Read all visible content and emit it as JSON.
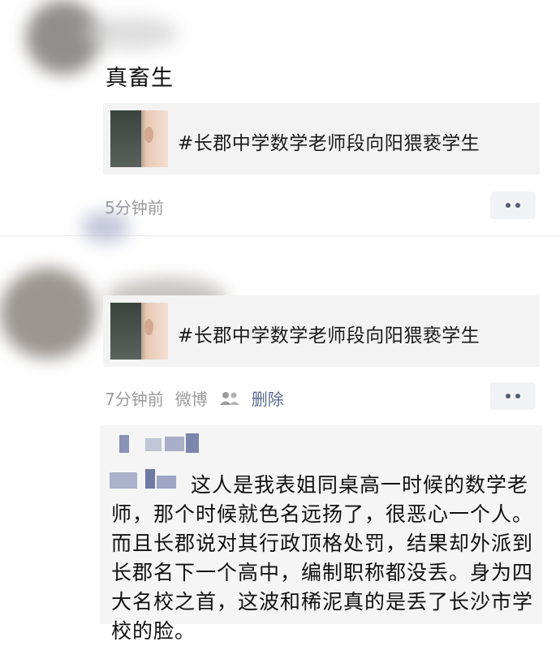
{
  "post1": {
    "text": "真畜生",
    "share_title": "#长郡中学数学老师段向阳猥亵学生",
    "time": "5分钟前"
  },
  "post2": {
    "share_title": "#长郡中学数学老师段向阳猥亵学生",
    "time": "7分钟前",
    "source": "微博",
    "delete_label": "删除"
  },
  "comment": {
    "text": "这人是我表姐同桌高一时候的数学老师，那个时候就色名远扬了，很恶心一个人。而且长郡说对其行政顶格处罚，结果却外派到长郡名下一个高中，编制职称都没丢。身为四大名校之首，这波和稀泥真的是丢了长沙市学校的脸。"
  },
  "icons": {
    "privacy": "people-icon",
    "more": "more-dots-icon"
  },
  "colors": {
    "link": "#5b6b93",
    "meta": "#9b9b9b",
    "card_bg": "#f3f3f3"
  }
}
